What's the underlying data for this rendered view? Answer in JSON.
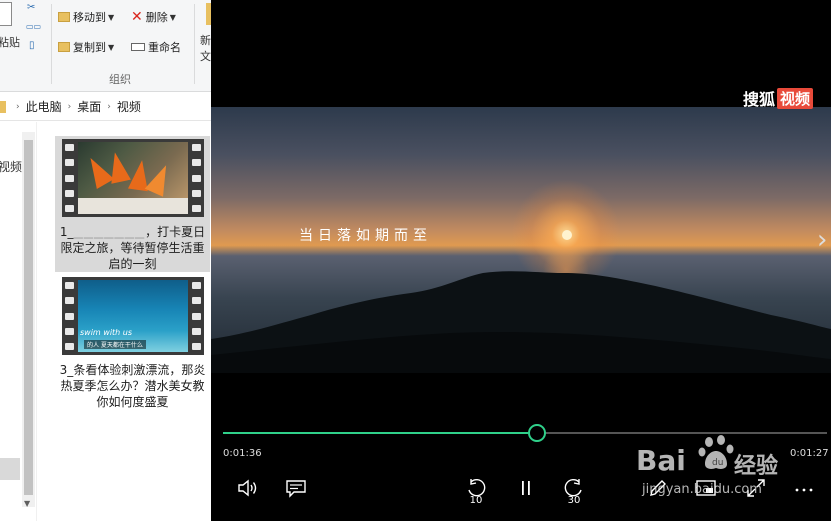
{
  "ribbon": {
    "paste_label": "粘贴",
    "move_to_label": "移动到",
    "copy_to_label": "复制到",
    "delete_label": "删除",
    "rename_label": "重命名",
    "new_label": "新\n文",
    "group_label": "组织",
    "delete_color": "#d9251d"
  },
  "address": {
    "crumbs": [
      "此电脑",
      "桌面",
      "视频"
    ]
  },
  "nav": {
    "item_label": "视频"
  },
  "files": [
    {
      "name_prefix": "1_",
      "name_blur": "▁▁▁▁▁▁▁",
      "name_rest": "，打卡夏日限定之旅，等待暂停生活重启的一刻",
      "selected": true
    },
    {
      "name_prefix": "3_",
      "name_blur": "",
      "name_rest": "条看体验刺激漂流，那炎热夏季怎么办？潜水美女教你如何度盛夏",
      "thumb_caption": "swim with us",
      "thumb_tag": "的人 夏天都在干什么",
      "selected": false
    }
  ],
  "player": {
    "subtitle": "当日落如期而至",
    "brand_text": "搜狐",
    "brand_badge": "视频",
    "brand_color": "#e84a3a",
    "accent_color": "#2fd08a",
    "progress": 0.52,
    "time_elapsed": "0:01:36",
    "time_remaining": "0:01:27",
    "skip_back_seconds": "10",
    "skip_forward_seconds": "30",
    "controls": [
      "volume-icon",
      "subtitles-icon",
      "skip-back-icon",
      "pause-icon",
      "skip-forward-icon",
      "edit-icon",
      "mini-view-icon",
      "fullscreen-icon",
      "more-icon"
    ]
  },
  "watermark": {
    "brand": "Bai",
    "brand_suffix": "经验",
    "url": "jingyan.baidu.com"
  }
}
